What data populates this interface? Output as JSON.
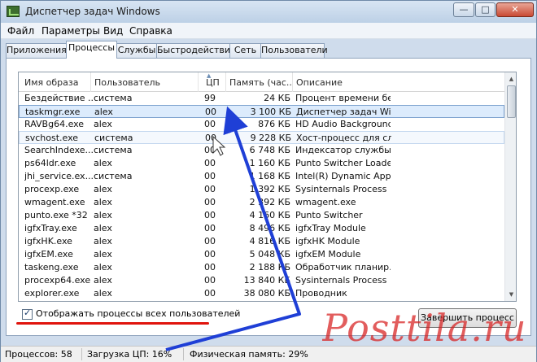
{
  "window": {
    "title": "Диспетчер задач Windows",
    "min": "—",
    "max": "□",
    "close": "✕"
  },
  "menu": [
    "Файл",
    "Параметры",
    "Вид",
    "Справка"
  ],
  "tabs": [
    "Приложения",
    "Процессы",
    "Службы",
    "Быстродействие",
    "Сеть",
    "Пользователи"
  ],
  "active_tab": "Процессы",
  "columns": [
    "Имя образа",
    "Пользователь",
    "ЦП",
    "Память (час...",
    "Описание"
  ],
  "rows": [
    [
      "Бездействие ...",
      "система",
      "99",
      "24 КБ",
      "Процент времени бе..."
    ],
    [
      "taskmgr.exe",
      "alex",
      "00",
      "3 100 КБ",
      "Диспетчер задач Wi..."
    ],
    [
      "RAVBg64.exe",
      "alex",
      "00",
      "876 КБ",
      "HD Audio Background ..."
    ],
    [
      "svchost.exe",
      "система",
      "00",
      "9 228 КБ",
      "Хост-процесс для сл..."
    ],
    [
      "SearchIndexe...",
      "система",
      "00",
      "6 748 КБ",
      "Индексатор службы ..."
    ],
    [
      "ps64ldr.exe",
      "alex",
      "00",
      "1 160 КБ",
      "Punto Switcher Loade..."
    ],
    [
      "jhi_service.ex...",
      "система",
      "00",
      "1 168 КБ",
      "Intel(R) Dynamic Appli..."
    ],
    [
      "procexp.exe",
      "alex",
      "00",
      "1 392 КБ",
      "Sysinternals Process ..."
    ],
    [
      "wmagent.exe",
      "alex",
      "00",
      "2 392 КБ",
      "wmagent.exe"
    ],
    [
      "punto.exe *32",
      "alex",
      "00",
      "4 160 КБ",
      "Punto Switcher"
    ],
    [
      "igfxTray.exe",
      "alex",
      "00",
      "8 496 КБ",
      "igfxTray Module"
    ],
    [
      "igfxHK.exe",
      "alex",
      "00",
      "4 816 КБ",
      "igfxHK Module"
    ],
    [
      "igfxEM.exe",
      "alex",
      "00",
      "5 048 КБ",
      "igfxEM Module"
    ],
    [
      "taskeng.exe",
      "alex",
      "00",
      "2 188 КБ",
      "Обработчик планир..."
    ],
    [
      "procexp64.exe",
      "alex",
      "00",
      "13 840 КБ",
      "Sysinternals Process ..."
    ],
    [
      "explorer.exe",
      "alex",
      "00",
      "38 080 КБ",
      "Проводник"
    ]
  ],
  "selected_row": "taskmgr.exe",
  "show_all_users": {
    "label": "Отображать процессы всех пользователей",
    "checked": true
  },
  "end_process_button": "Завершить процесс",
  "status": {
    "processes": "Процессов: 58",
    "cpu": "Загрузка ЦП: 16%",
    "memory": "Физическая память: 29%"
  },
  "watermark": "Posttila.ru",
  "colors": {
    "annotation_arrow": "#1f3fd6",
    "annotation_underline": "#e0140c",
    "selection": "#dcebfc"
  }
}
